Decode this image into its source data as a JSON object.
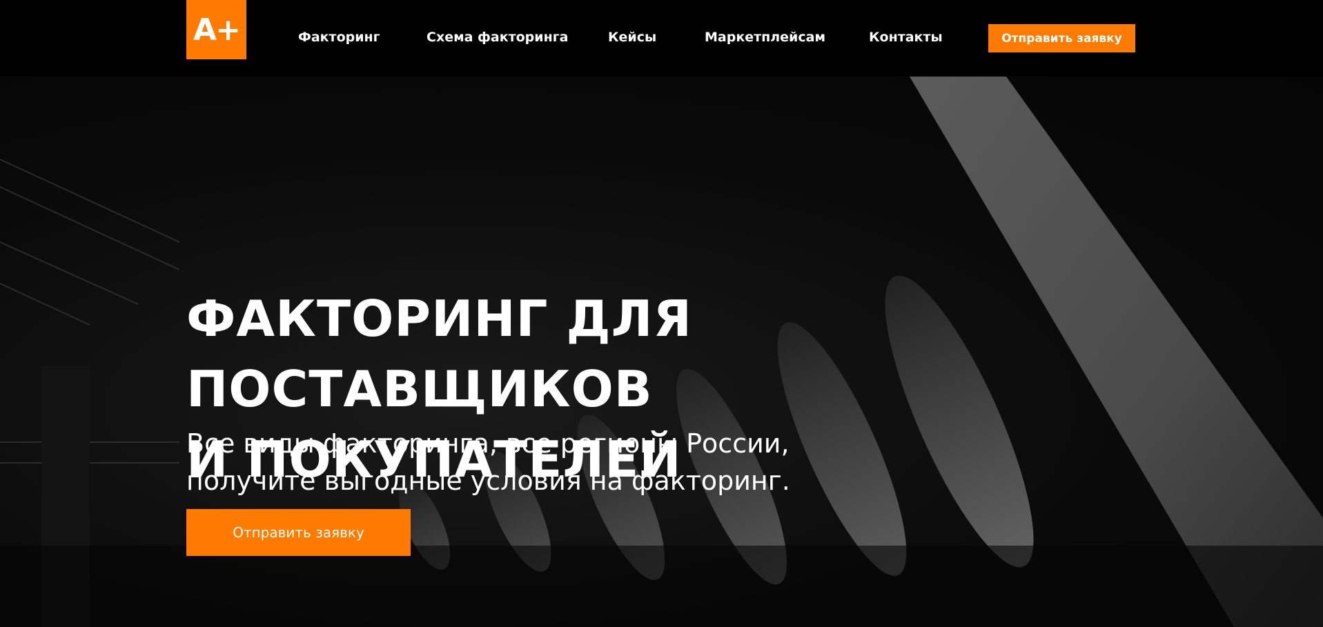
{
  "header": {
    "logo_text": "A+",
    "nav": [
      {
        "label": "Факторинг"
      },
      {
        "label": "Схема факторинга"
      },
      {
        "label": "Кейсы"
      },
      {
        "label": "Маркетплейсам"
      },
      {
        "label": "Контакты"
      }
    ],
    "cta_label": "Отправить заявку"
  },
  "hero": {
    "title_line1": "ФАКТОРИНГ ДЛЯ ПОСТАВЩИКОВ",
    "title_line2": "И ПОКУПАТЕЛЕЙ",
    "subtitle_line1": "Все виды факторинга, все регионы России,",
    "subtitle_line2": "получите выгодные условия на факторинг.",
    "cta_label": "Отправить заявку"
  },
  "colors": {
    "accent": "#ff7a00",
    "background": "#000000"
  }
}
